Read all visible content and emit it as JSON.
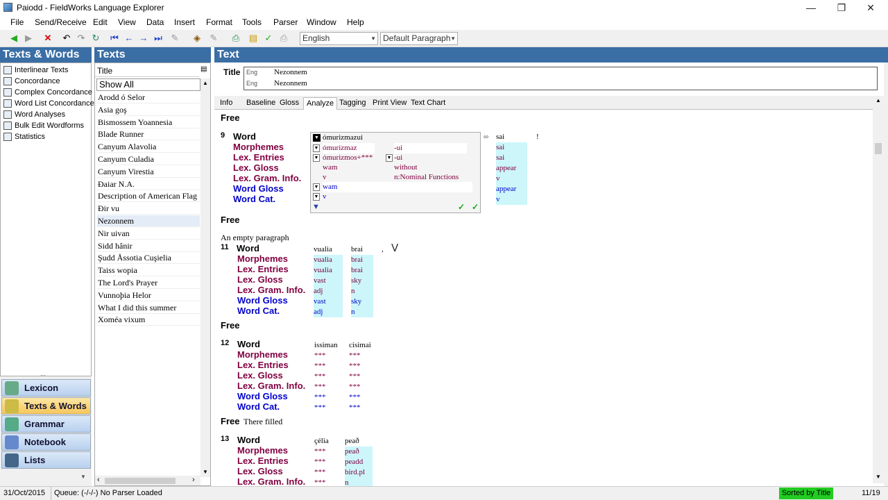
{
  "window": {
    "title": "Paiodd - FieldWorks Language Explorer"
  },
  "menu": [
    "File",
    "Send/Receive",
    "Edit",
    "View",
    "Data",
    "Insert",
    "Format",
    "Tools",
    "Parser",
    "Window",
    "Help"
  ],
  "toolbar": {
    "writing_system": "English",
    "style": "Default Paragraph"
  },
  "panes": {
    "left": "Texts & Words",
    "middle": "Texts",
    "right": "Text"
  },
  "tools": [
    "Interlinear Texts",
    "Concordance",
    "Complex Concordance",
    "Word List Concordance",
    "Word Analyses",
    "Bulk Edit Wordforms",
    "Statistics"
  ],
  "areas": [
    "Lexicon",
    "Texts & Words",
    "Grammar",
    "Notebook",
    "Lists"
  ],
  "texts_list": {
    "column": "Title",
    "filter": "Show All",
    "items": [
      "Arodd ó Selor",
      "Asia goş",
      "Bismossem Yoannesia",
      "Blade Runner",
      "Canyum Alavolia",
      "Canyum Culadia",
      "Canyum Virestia",
      "Đaiar N.A.",
      "Description of American Flag",
      "Đir vu",
      "Nezonnem",
      "Nir uivan",
      "Sidd hânir",
      "Şudd Åssotia Cuşielia",
      "Taiss wopia",
      "The Lord's Prayer",
      "Vunnoþia Helor",
      "What I did this summer",
      "Xoméa vixum"
    ],
    "selected": "Nezonnem"
  },
  "text": {
    "title_label": "Title",
    "titles": [
      {
        "ws": "Eng",
        "value": "Nezonnem"
      },
      {
        "ws": "Eng",
        "value": "Nezonnem"
      }
    ],
    "tabs": [
      "Info",
      "Baseline",
      "Gloss",
      "Analyze",
      "Tagging",
      "Print View",
      "Text Chart"
    ],
    "active_tab": "Analyze"
  },
  "rows": {
    "word": "Word",
    "morphemes": "Morphemes",
    "lex_entries": "Lex. Entries",
    "lex_gloss": "Lex. Gloss",
    "lex_gram": "Lex. Gram. Info.",
    "word_gloss": "Word Gloss",
    "word_cat": "Word Cat.",
    "free": "Free"
  },
  "seg9": {
    "num": "9",
    "sandbox": {
      "word": "ómurizmazui",
      "morph1": "ómurizmaz",
      "morph2": "-ui",
      "entry1": "ómurizmos+***",
      "entry2": "-ui",
      "gloss1": "wam",
      "gloss2": "without",
      "gram1": "v",
      "gram2": "n:Nominal Functions",
      "word_gloss": "wam",
      "word_cat": "v"
    },
    "w2": {
      "word": "sai",
      "morph": "sai",
      "entry": "sai",
      "gloss": "appear",
      "gram": "v",
      "wgloss": "appear",
      "wcat": "v"
    },
    "punct": "!"
  },
  "free_empty": "An empty paragraph",
  "seg11": {
    "num": "11",
    "words": [
      {
        "word": "vualia",
        "morph": "vualia",
        "entry": "vualia",
        "gloss": "vast",
        "gram": "adj",
        "wgloss": "vast",
        "wcat": "adj"
      },
      {
        "word": "brai",
        "morph": "brai",
        "entry": "brai",
        "gloss": "sky",
        "gram": "n",
        "wgloss": "sky",
        "wcat": "n"
      }
    ],
    "punct": ","
  },
  "seg12": {
    "num": "12",
    "words": [
      {
        "word": "issiman",
        "morph": "***",
        "entry": "***",
        "gloss": "***",
        "gram": "***",
        "wgloss": "***",
        "wcat": "***"
      },
      {
        "word": "cisimai",
        "morph": "***",
        "entry": "***",
        "gloss": "***",
        "gram": "***",
        "wgloss": "***",
        "wcat": "***"
      }
    ]
  },
  "free12": "There filled",
  "seg13": {
    "num": "13",
    "words": [
      {
        "word": "çélia",
        "morph": "***",
        "entry": "***",
        "gloss": "***",
        "gram": "***"
      },
      {
        "word": "peað",
        "morph": "peað",
        "entry": "peadd",
        "gloss": "bird.pl",
        "gram": "n"
      }
    ]
  },
  "status": {
    "date": "31/Oct/2015",
    "queue": "Queue: (-/-/-) No Parser Loaded",
    "sort": "Sorted by Title",
    "count": "11/19",
    "sort_color": "#22cc22"
  }
}
